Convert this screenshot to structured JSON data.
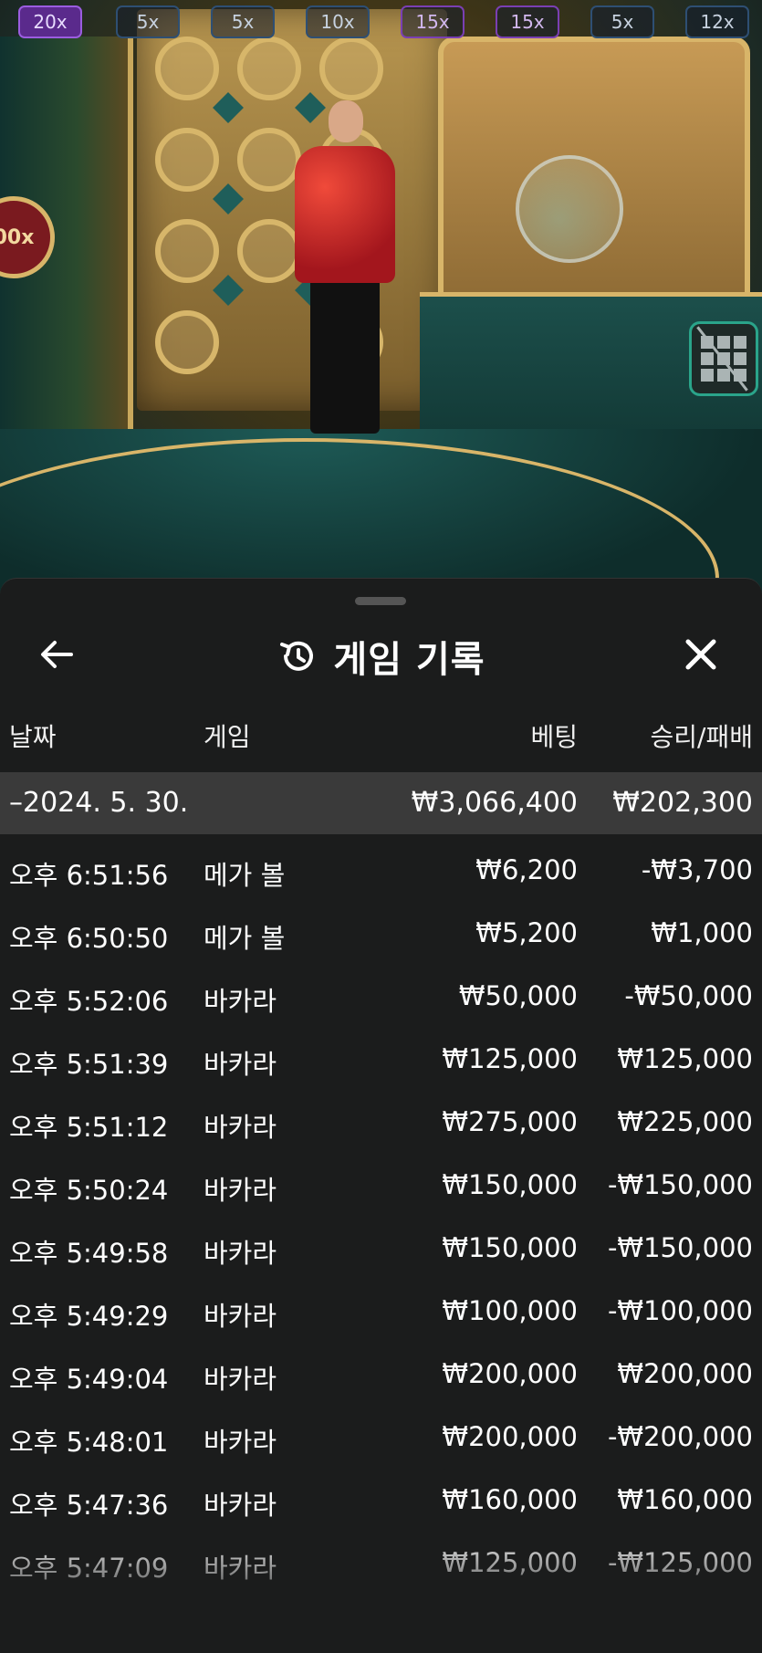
{
  "multipliers": [
    "20x",
    "5x",
    "5x",
    "10x",
    "15x",
    "15x",
    "5x",
    "12x"
  ],
  "video": {
    "badge": "00x"
  },
  "history": {
    "title": "게임 기록",
    "columns": {
      "date": "날짜",
      "game": "게임",
      "bet": "베팅",
      "winloss": "승리/패배"
    },
    "group": {
      "label": "–2024. 5. 30.",
      "bet": "₩3,066,400",
      "winloss": "₩202,300"
    },
    "rows": [
      {
        "time": "오후 6:51:56",
        "game": "메가 볼",
        "bet": "₩6,200",
        "winloss": "-₩3,700"
      },
      {
        "time": "오후 6:50:50",
        "game": "메가 볼",
        "bet": "₩5,200",
        "winloss": "₩1,000"
      },
      {
        "time": "오후 5:52:06",
        "game": "바카라",
        "bet": "₩50,000",
        "winloss": "-₩50,000"
      },
      {
        "time": "오후 5:51:39",
        "game": "바카라",
        "bet": "₩125,000",
        "winloss": "₩125,000"
      },
      {
        "time": "오후 5:51:12",
        "game": "바카라",
        "bet": "₩275,000",
        "winloss": "₩225,000"
      },
      {
        "time": "오후 5:50:24",
        "game": "바카라",
        "bet": "₩150,000",
        "winloss": "-₩150,000"
      },
      {
        "time": "오후 5:49:58",
        "game": "바카라",
        "bet": "₩150,000",
        "winloss": "-₩150,000"
      },
      {
        "time": "오후 5:49:29",
        "game": "바카라",
        "bet": "₩100,000",
        "winloss": "-₩100,000"
      },
      {
        "time": "오후 5:49:04",
        "game": "바카라",
        "bet": "₩200,000",
        "winloss": "₩200,000"
      },
      {
        "time": "오후 5:48:01",
        "game": "바카라",
        "bet": "₩200,000",
        "winloss": "-₩200,000"
      },
      {
        "time": "오후 5:47:36",
        "game": "바카라",
        "bet": "₩160,000",
        "winloss": "₩160,000"
      },
      {
        "time": "오후 5:47:09",
        "game": "바카라",
        "bet": "₩125,000",
        "winloss": "-₩125,000"
      }
    ]
  },
  "icons": {
    "back": "arrow-left-icon",
    "history": "history-clock-icon",
    "close": "close-icon",
    "grid": "grid-toggle-icon"
  }
}
